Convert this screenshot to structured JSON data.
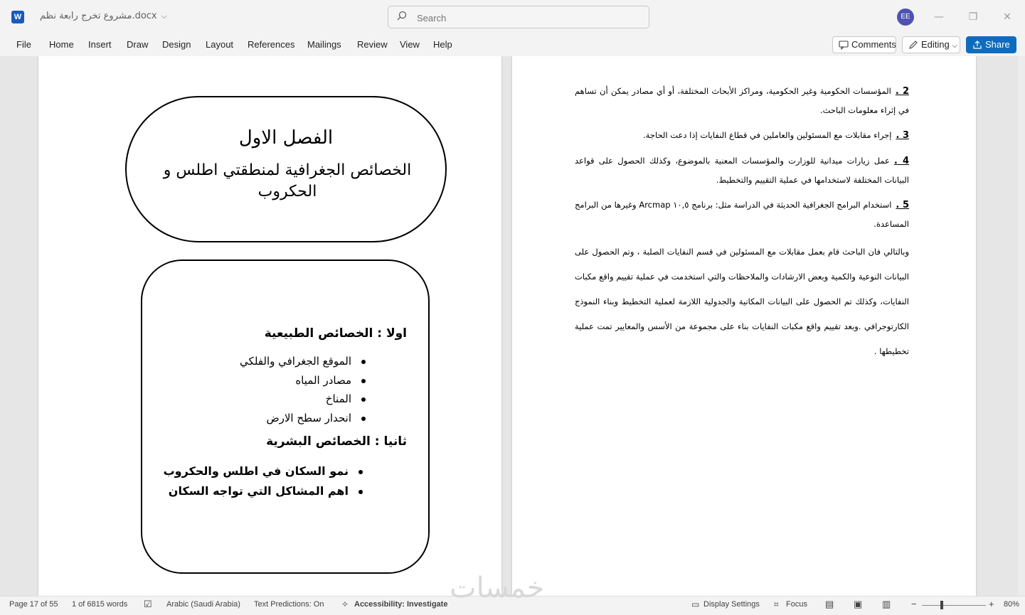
{
  "titlebar": {
    "app_logo": "W",
    "document_name": "مشروع تخرج رابعة نظم.docx",
    "search_placeholder": "Search",
    "avatar_initials": "EE"
  },
  "menu": {
    "items": [
      "File",
      "Home",
      "Insert",
      "Draw",
      "Design",
      "Layout",
      "References",
      "Mailings",
      "Review",
      "View",
      "Help"
    ],
    "comments_label": "Comments",
    "editing_label": "Editing",
    "share_label": "Share",
    "accent_color": "#0f6cbd"
  },
  "left_page": {
    "chapter_title": "الفصل الاول",
    "chapter_subtitle": "الخصائص الجغرافية لمنطقتي اطلس و الحكروب",
    "section1_heading": "اولا : الخصائص الطبيعية",
    "section1_items": [
      "الموقع الجغرافي والفلكي",
      "مصادر المياه",
      "المناخ",
      "انحدار سطح الارض"
    ],
    "section2_heading": "ثانيا : الخصائص البشرية",
    "section2_items": [
      "نمو السكان في اطلس والحكروب",
      "اهم المشاكل التي تواجه السكان"
    ]
  },
  "right_page": {
    "items": [
      {
        "num": "2 .",
        "text": "المؤسسات الحكومية وغير الحكومية، ومراكز الأبحاث المختلفة، أو أي مصادر يمكن أن تساهم في إثراء معلومات الباحث."
      },
      {
        "num": "3 .",
        "text": "إجراء مقابلات مع المسئولين والعاملين في قطاع النفايات إذا دعت الحاجة."
      },
      {
        "num": "4 .",
        "text": "عمل زيارات ميدانية للوزارت والمؤسسات المعنية بالموضوع، وكذلك الحصول على قواعد البيانات المختلفة لاستخدامها في عملية التقييم والتخطيط."
      },
      {
        "num": "5 .",
        "text": "استخدام البرامج الجغرافية الحديثة في الدراسة مثل: برنامج ١٠,٥ Arcmap وغيرها من البرامج المساعدة."
      }
    ],
    "paragraph": "وبالتالي فان الباحث قام بعمل مقابلات مع المسئولين في قسم النفايات الصلبة ، وتم الحصول على البيانات النوعية والكمية وبعض الارشادات والملاحظات والتي استخدمت في عملية تقييم واقع مكبات النفايات، وكذلك تم الحصول على البيانات المكانية والجدولية اللازمة لعملية التخطيط وبناء النموذج الكارتوجرافي .وبعد تقييم واقع مكبات النفايات بناء على مجموعة من الأسس والمعايير تمت عملية تخطيطها ."
  },
  "statusbar": {
    "page": "Page 17 of 55",
    "words": "1 of 6815 words",
    "language": "Arabic (Saudi Arabia)",
    "text_predictions": "Text Predictions: On",
    "accessibility": "Accessibility: Investigate",
    "display_settings": "Display Settings",
    "focus": "Focus",
    "zoom": "80%",
    "zoom_level": 0.8
  },
  "watermark": "خمسات"
}
